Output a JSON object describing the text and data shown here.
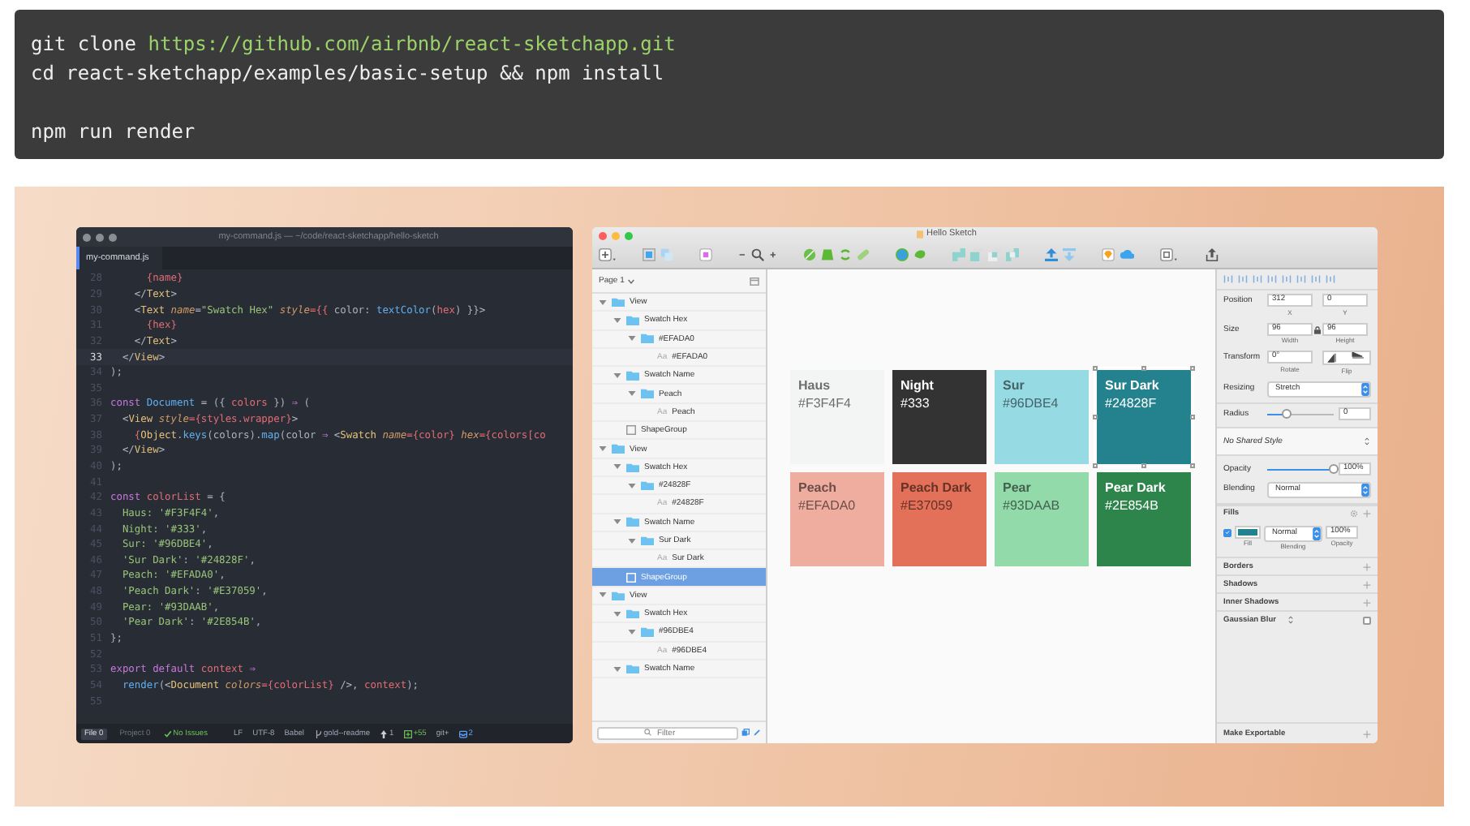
{
  "command_block": {
    "groups": [
      [
        {
          "segments": [
            {
              "text": "git clone ",
              "kind": "cmd"
            },
            {
              "text": "https://github.com/airbnb/react-sketchapp.git",
              "kind": "url"
            }
          ]
        },
        {
          "segments": [
            {
              "text": "cd react-sketchapp/examples/basic-setup && npm install",
              "kind": "cmd"
            }
          ]
        }
      ],
      [
        {
          "segments": [
            {
              "text": "npm run render",
              "kind": "cmd"
            }
          ]
        }
      ]
    ]
  },
  "editor": {
    "title": "my-command.js — ~/code/react-sketchapp/hello-sketch",
    "tab": "my-command.js",
    "lines": [
      {
        "number": "28",
        "current": false,
        "segments": [
          {
            "text": "      {name}",
            "kind": "var"
          }
        ]
      },
      {
        "number": "29",
        "current": false,
        "segments": [
          {
            "text": "    </",
            "kind": "punct"
          },
          {
            "text": "Text",
            "kind": "tag"
          },
          {
            "text": ">",
            "kind": "punct"
          }
        ]
      },
      {
        "number": "30",
        "current": false,
        "segments": [
          {
            "text": "    <",
            "kind": "punct"
          },
          {
            "text": "Text ",
            "kind": "tag"
          },
          {
            "text": "name",
            "kind": "attr"
          },
          {
            "text": "=",
            "kind": "punct"
          },
          {
            "text": "\"Swatch Hex\" ",
            "kind": "str"
          },
          {
            "text": "style",
            "kind": "attr"
          },
          {
            "text": "={{ ",
            "kind": "var"
          },
          {
            "text": "color: ",
            "kind": "plain"
          },
          {
            "text": "textColor",
            "kind": "fn"
          },
          {
            "text": "(",
            "kind": "punct"
          },
          {
            "text": "hex",
            "kind": "var"
          },
          {
            "text": ") }}",
            "kind": "plain"
          },
          {
            "text": ">",
            "kind": "punct"
          }
        ]
      },
      {
        "number": "31",
        "current": false,
        "segments": [
          {
            "text": "      {hex}",
            "kind": "var"
          }
        ]
      },
      {
        "number": "32",
        "current": false,
        "segments": [
          {
            "text": "    </",
            "kind": "punct"
          },
          {
            "text": "Text",
            "kind": "tag"
          },
          {
            "text": ">",
            "kind": "punct"
          }
        ]
      },
      {
        "number": "33",
        "current": true,
        "segments": [
          {
            "text": "  </",
            "kind": "punct"
          },
          {
            "text": "View",
            "kind": "tag"
          },
          {
            "text": ">",
            "kind": "punct"
          }
        ]
      },
      {
        "number": "34",
        "current": false,
        "segments": [
          {
            "text": ");",
            "kind": "punct"
          }
        ]
      },
      {
        "number": "35",
        "current": false
      },
      {
        "number": "36",
        "current": false,
        "segments": [
          {
            "text": "const ",
            "kind": "kw"
          },
          {
            "text": "Document",
            "kind": "fn"
          },
          {
            "text": " = ({ ",
            "kind": "punct"
          },
          {
            "text": "colors",
            "kind": "var"
          },
          {
            "text": " }) ",
            "kind": "punct"
          },
          {
            "text": "⇒",
            "kind": "kw"
          },
          {
            "text": " (",
            "kind": "punct"
          }
        ]
      },
      {
        "number": "37",
        "current": false,
        "segments": [
          {
            "text": "  <",
            "kind": "punct"
          },
          {
            "text": "View ",
            "kind": "tag"
          },
          {
            "text": "style",
            "kind": "attr"
          },
          {
            "text": "={styles.wrapper}",
            "kind": "var"
          },
          {
            "text": ">",
            "kind": "punct"
          }
        ]
      },
      {
        "number": "38",
        "current": false,
        "segments": [
          {
            "text": "    {",
            "kind": "var"
          },
          {
            "text": "Object",
            "kind": "tag"
          },
          {
            "text": ".",
            "kind": "punct"
          },
          {
            "text": "keys",
            "kind": "fn"
          },
          {
            "text": "(colors).",
            "kind": "punct"
          },
          {
            "text": "map",
            "kind": "fn"
          },
          {
            "text": "(color ",
            "kind": "punct"
          },
          {
            "text": "⇒",
            "kind": "kw"
          },
          {
            "text": " <",
            "kind": "punct"
          },
          {
            "text": "Swatch ",
            "kind": "tag"
          },
          {
            "text": "name",
            "kind": "attr"
          },
          {
            "text": "={color} ",
            "kind": "var"
          },
          {
            "text": "hex",
            "kind": "attr"
          },
          {
            "text": "={colors[co",
            "kind": "var"
          }
        ]
      },
      {
        "number": "39",
        "current": false,
        "segments": [
          {
            "text": "  </",
            "kind": "punct"
          },
          {
            "text": "View",
            "kind": "tag"
          },
          {
            "text": ">",
            "kind": "punct"
          }
        ]
      },
      {
        "number": "40",
        "current": false,
        "segments": [
          {
            "text": ");",
            "kind": "punct"
          }
        ]
      },
      {
        "number": "41",
        "current": false
      },
      {
        "number": "42",
        "current": false,
        "segments": [
          {
            "text": "const ",
            "kind": "kw"
          },
          {
            "text": "colorList",
            "kind": "var"
          },
          {
            "text": " = {",
            "kind": "punct"
          }
        ]
      },
      {
        "number": "43",
        "current": false,
        "segments": [
          {
            "text": "  Haus: ",
            "kind": "prop"
          },
          {
            "text": "'#F3F4F4'",
            "kind": "str"
          },
          {
            "text": ",",
            "kind": "punct"
          }
        ]
      },
      {
        "number": "44",
        "current": false,
        "segments": [
          {
            "text": "  Night: ",
            "kind": "prop"
          },
          {
            "text": "'#333'",
            "kind": "str"
          },
          {
            "text": ",",
            "kind": "punct"
          }
        ]
      },
      {
        "number": "45",
        "current": false,
        "segments": [
          {
            "text": "  Sur: ",
            "kind": "prop"
          },
          {
            "text": "'#96DBE4'",
            "kind": "str"
          },
          {
            "text": ",",
            "kind": "punct"
          }
        ]
      },
      {
        "number": "46",
        "current": false,
        "segments": [
          {
            "text": "  'Sur Dark'",
            "kind": "prop"
          },
          {
            "text": ": ",
            "kind": "punct"
          },
          {
            "text": "'#24828F'",
            "kind": "str"
          },
          {
            "text": ",",
            "kind": "punct"
          }
        ]
      },
      {
        "number": "47",
        "current": false,
        "segments": [
          {
            "text": "  Peach: ",
            "kind": "prop"
          },
          {
            "text": "'#EFADA0'",
            "kind": "str"
          },
          {
            "text": ",",
            "kind": "punct"
          }
        ]
      },
      {
        "number": "48",
        "current": false,
        "segments": [
          {
            "text": "  'Peach Dark'",
            "kind": "prop"
          },
          {
            "text": ": ",
            "kind": "punct"
          },
          {
            "text": "'#E37059'",
            "kind": "str"
          },
          {
            "text": ",",
            "kind": "punct"
          }
        ]
      },
      {
        "number": "49",
        "current": false,
        "segments": [
          {
            "text": "  Pear: ",
            "kind": "prop"
          },
          {
            "text": "'#93DAAB'",
            "kind": "str"
          },
          {
            "text": ",",
            "kind": "punct"
          }
        ]
      },
      {
        "number": "50",
        "current": false,
        "segments": [
          {
            "text": "  'Pear Dark'",
            "kind": "prop"
          },
          {
            "text": ": ",
            "kind": "punct"
          },
          {
            "text": "'#2E854B'",
            "kind": "str"
          },
          {
            "text": ",",
            "kind": "punct"
          }
        ]
      },
      {
        "number": "51",
        "current": false,
        "segments": [
          {
            "text": "};",
            "kind": "punct"
          }
        ]
      },
      {
        "number": "52",
        "current": false
      },
      {
        "number": "53",
        "current": false,
        "segments": [
          {
            "text": "export default ",
            "kind": "kw"
          },
          {
            "text": "context ",
            "kind": "var"
          },
          {
            "text": "⇒",
            "kind": "kw"
          }
        ]
      },
      {
        "number": "54",
        "current": false,
        "segments": [
          {
            "text": "  render",
            "kind": "fn"
          },
          {
            "text": "(<",
            "kind": "punct"
          },
          {
            "text": "Document ",
            "kind": "tag"
          },
          {
            "text": "colors",
            "kind": "attr"
          },
          {
            "text": "={colorList}",
            "kind": "var"
          },
          {
            "text": " />, ",
            "kind": "punct"
          },
          {
            "text": "context",
            "kind": "var"
          },
          {
            "text": ");",
            "kind": "punct"
          }
        ]
      },
      {
        "number": "55",
        "current": false
      }
    ],
    "status_bar": [
      {
        "kind": "tab",
        "text": "File",
        "count": "0",
        "selected": true
      },
      {
        "kind": "tab",
        "text": "Project",
        "count": "0",
        "selected": false
      },
      {
        "kind": "issues",
        "text": "No Issues"
      },
      {
        "kind": "plain",
        "text": "LF"
      },
      {
        "kind": "plain",
        "text": "UTF-8"
      },
      {
        "kind": "plain",
        "text": "Babel"
      },
      {
        "kind": "branch",
        "text": "gold--readme"
      },
      {
        "kind": "push",
        "text": "1"
      },
      {
        "kind": "diff",
        "text": "+55"
      },
      {
        "kind": "plain",
        "text": "git+"
      },
      {
        "kind": "github",
        "text": "2"
      }
    ]
  },
  "sketch": {
    "title": "Hello Sketch",
    "page": "Page 1",
    "layers": [
      {
        "name": "View",
        "kind": "folder",
        "expanded": true,
        "selected": false,
        "children": [
          {
            "name": "Swatch Hex",
            "kind": "folder",
            "expanded": true,
            "selected": false,
            "children": [
              {
                "name": "#EFADA0",
                "kind": "folder",
                "expanded": true,
                "selected": false,
                "children": [
                  {
                    "name": "#EFADA0",
                    "kind": "text",
                    "glyph": "Aa",
                    "selected": false
                  }
                ]
              }
            ]
          },
          {
            "name": "Swatch Name",
            "kind": "folder",
            "expanded": true,
            "selected": false,
            "children": [
              {
                "name": "Peach",
                "kind": "folder",
                "expanded": true,
                "selected": false,
                "children": [
                  {
                    "name": "Peach",
                    "kind": "text",
                    "glyph": "Aa",
                    "selected": false
                  }
                ]
              }
            ]
          },
          {
            "name": "ShapeGroup",
            "kind": "shape",
            "selected": false
          }
        ]
      },
      {
        "name": "View",
        "kind": "folder",
        "expanded": true,
        "selected": false,
        "children": [
          {
            "name": "Swatch Hex",
            "kind": "folder",
            "expanded": true,
            "selected": false,
            "children": [
              {
                "name": "#24828F",
                "kind": "folder",
                "expanded": true,
                "selected": false,
                "children": [
                  {
                    "name": "#24828F",
                    "kind": "text",
                    "glyph": "Aa",
                    "selected": false
                  }
                ]
              }
            ]
          },
          {
            "name": "Swatch Name",
            "kind": "folder",
            "expanded": true,
            "selected": false,
            "children": [
              {
                "name": "Sur Dark",
                "kind": "folder",
                "expanded": true,
                "selected": false,
                "children": [
                  {
                    "name": "Sur Dark",
                    "kind": "text",
                    "glyph": "Aa",
                    "selected": false
                  }
                ]
              }
            ]
          },
          {
            "name": "ShapeGroup",
            "kind": "shape",
            "selected": true
          }
        ]
      },
      {
        "name": "View",
        "kind": "folder",
        "expanded": true,
        "selected": false,
        "children": [
          {
            "name": "Swatch Hex",
            "kind": "folder",
            "expanded": true,
            "selected": false,
            "children": [
              {
                "name": "#96DBE4",
                "kind": "folder",
                "expanded": true,
                "selected": false,
                "children": [
                  {
                    "name": "#96DBE4",
                    "kind": "text",
                    "glyph": "Aa",
                    "selected": false
                  }
                ]
              }
            ]
          },
          {
            "name": "Swatch Name",
            "kind": "folder",
            "expanded": true,
            "selected": false
          }
        ]
      }
    ],
    "filter": {
      "placeholder": "Filter"
    },
    "swatches": [
      {
        "name": "Haus",
        "hex": "#F3F4F4",
        "color": "#f3f4f4",
        "selected": false
      },
      {
        "name": "Night",
        "hex": "#333",
        "color": "#333333",
        "selected": false
      },
      {
        "name": "Sur",
        "hex": "#96DBE4",
        "color": "#96dbe4",
        "selected": false
      },
      {
        "name": "Sur Dark",
        "hex": "#24828F",
        "color": "#24828f",
        "selected": true
      },
      {
        "name": "Peach",
        "hex": "#EFADA0",
        "color": "#efada0",
        "selected": false
      },
      {
        "name": "Peach Dark",
        "hex": "#E37059",
        "color": "#e37059",
        "selected": false
      },
      {
        "name": "Pear",
        "hex": "#93DAAB",
        "color": "#93daab",
        "selected": false
      },
      {
        "name": "Pear Dark",
        "hex": "#2E854B",
        "color": "#2e854b",
        "selected": false
      }
    ],
    "inspector": {
      "rows": [
        {
          "kind": "pair",
          "label": "Position",
          "locked": false,
          "fields": [
            {
              "value": "312",
              "caption": "X"
            },
            {
              "value": "0",
              "caption": "Y"
            }
          ]
        },
        {
          "kind": "pair",
          "label": "Size",
          "locked": true,
          "fields": [
            {
              "value": "96",
              "caption": "Width"
            },
            {
              "value": "96",
              "caption": "Height"
            }
          ]
        },
        {
          "kind": "transform",
          "label": "Transform",
          "fields": [
            {
              "value": "0°",
              "caption": "Rotate"
            }
          ],
          "flip_caption": "Flip"
        },
        {
          "kind": "select",
          "label": "Resizing",
          "value": "Stretch"
        },
        {
          "kind": "slider",
          "label": "Radius",
          "level": 0.3,
          "value": "0"
        },
        {
          "kind": "style",
          "value": "No Shared Style"
        },
        {
          "kind": "slider",
          "label": "Opacity",
          "level": 1,
          "value": "100%"
        },
        {
          "kind": "select",
          "label": "Blending",
          "value": "Normal"
        },
        {
          "kind": "section",
          "label": "Fills",
          "settings": true
        },
        {
          "kind": "fill",
          "checked": true,
          "color": "#24828f",
          "blend": "Normal",
          "opacity": "100%",
          "captions": [
            "Fill",
            "Blending",
            "Opacity"
          ]
        },
        {
          "kind": "section",
          "label": "Borders",
          "settings": false
        },
        {
          "kind": "section",
          "label": "Shadows",
          "settings": false
        },
        {
          "kind": "section",
          "label": "Inner Shadows",
          "settings": false
        },
        {
          "kind": "toggle",
          "label": "Gaussian Blur",
          "checked": false
        }
      ],
      "footer": "Make Exportable"
    }
  }
}
